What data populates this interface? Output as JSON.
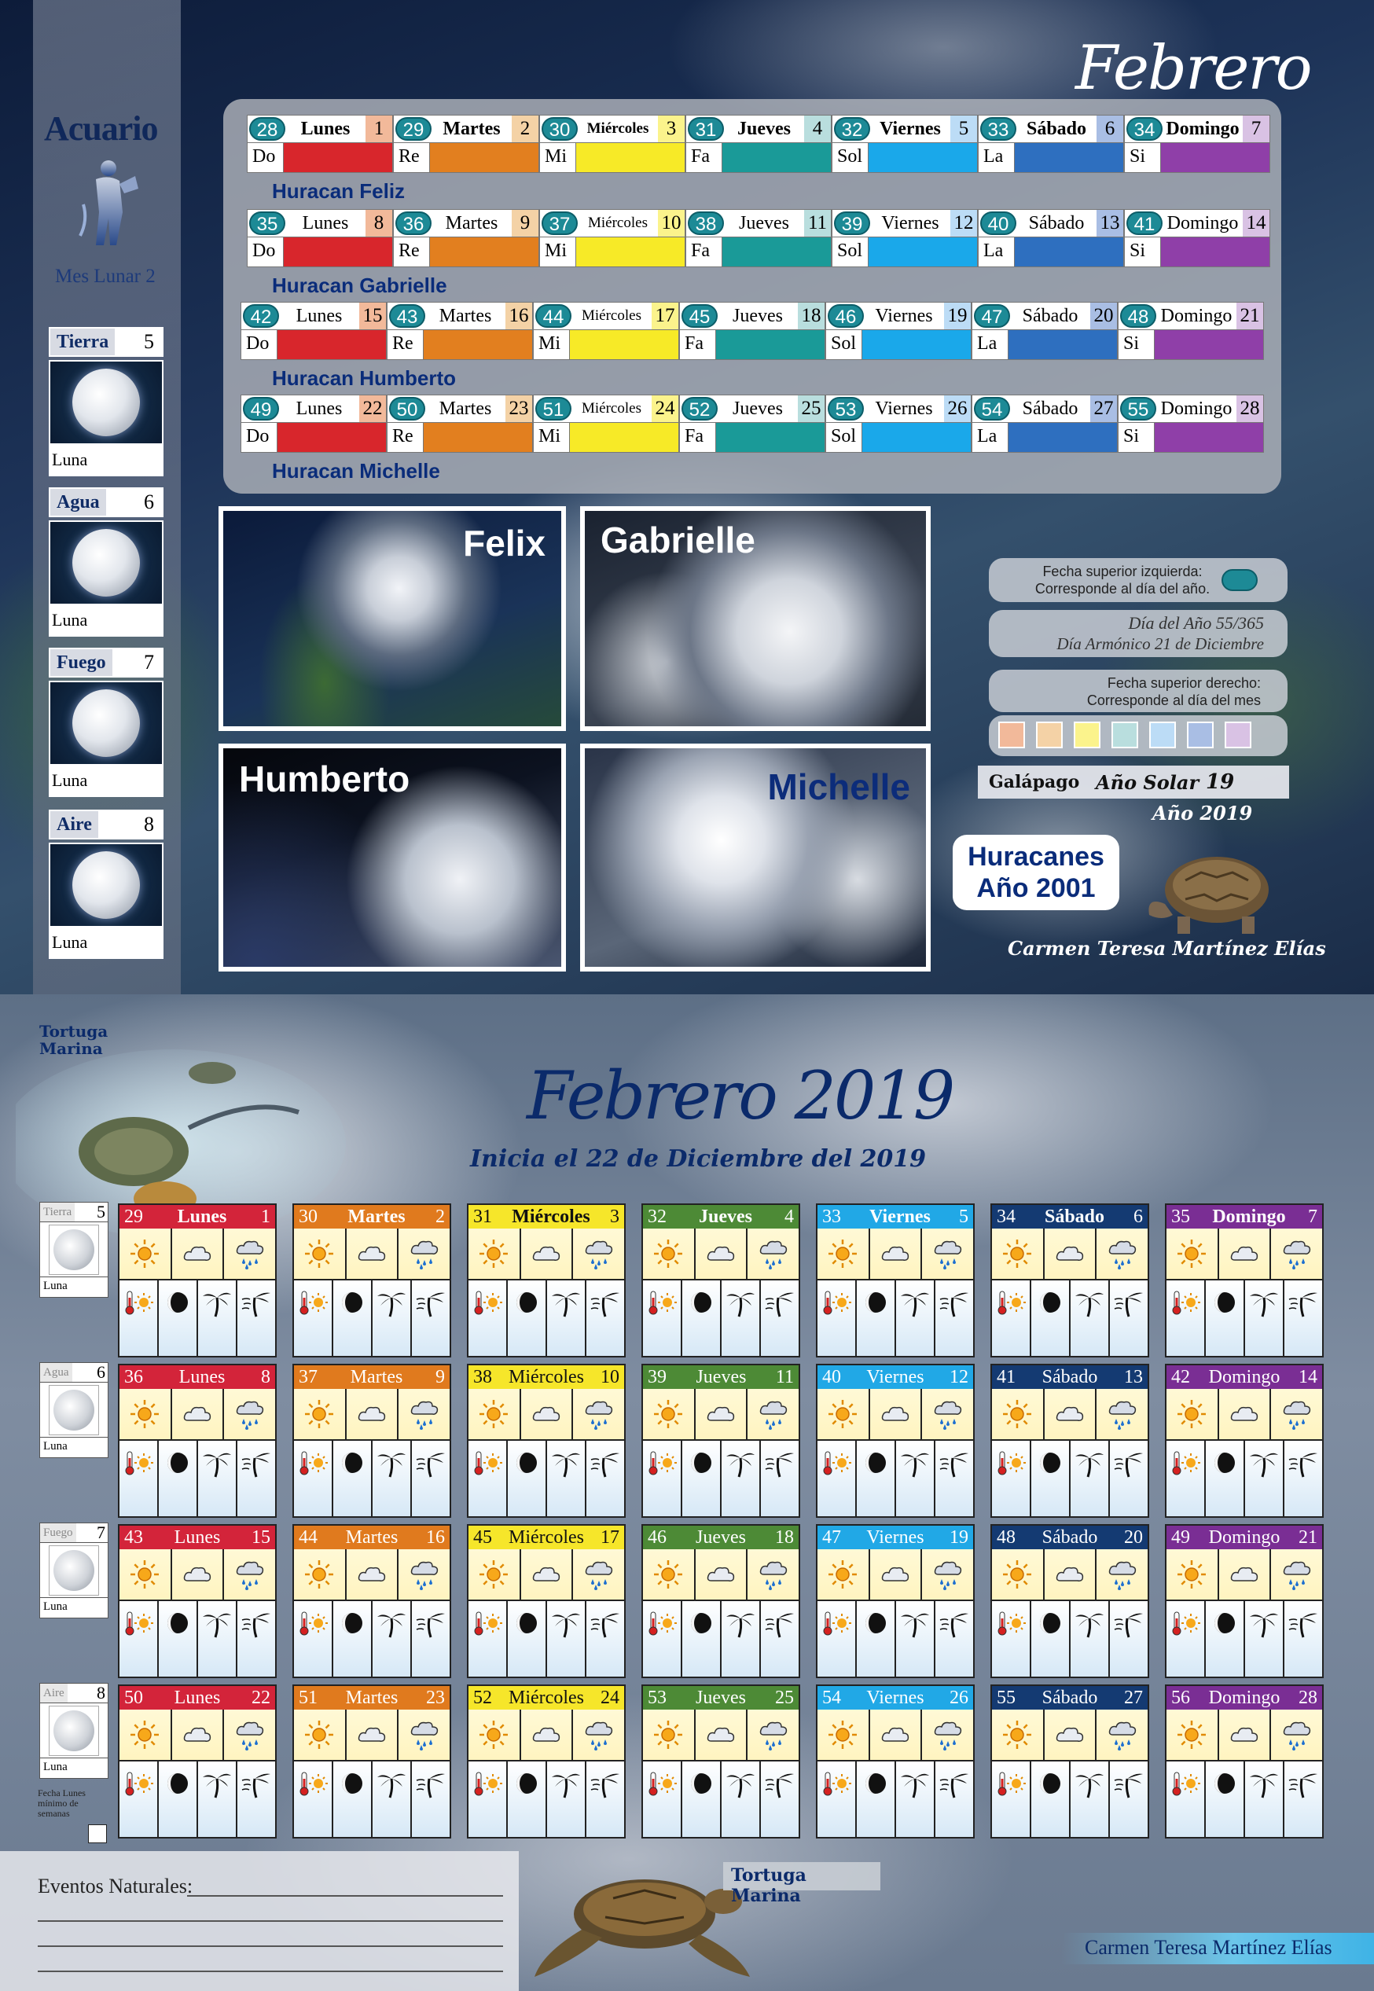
{
  "top": {
    "month_title": "Febrero",
    "sign": {
      "name": "Acuario",
      "lunar": "Mes Lunar 2"
    },
    "elements": [
      {
        "name": "Tierra",
        "num": "5",
        "label": "Luna"
      },
      {
        "name": "Agua",
        "num": "6",
        "label": "Luna"
      },
      {
        "name": "Fuego",
        "num": "7",
        "label": "Luna"
      },
      {
        "name": "Aire",
        "num": "8",
        "label": "Luna"
      }
    ],
    "notes": [
      "Do",
      "Re",
      "Mi",
      "Fa",
      "Sol",
      "La",
      "Si"
    ],
    "note_colors": [
      "#d8262c",
      "#e27f1f",
      "#f7ea27",
      "#1a9a98",
      "#1aa8ea",
      "#2e6fbf",
      "#8f3fa8"
    ],
    "weeks": [
      {
        "hurricane": "Huracan Feliz",
        "days": [
          {
            "doy": "28",
            "name": "Lunes",
            "num": "1"
          },
          {
            "doy": "29",
            "name": "Martes",
            "num": "2"
          },
          {
            "doy": "30",
            "name": "Miércoles",
            "num": "3"
          },
          {
            "doy": "31",
            "name": "Jueves",
            "num": "4"
          },
          {
            "doy": "32",
            "name": "Viernes",
            "num": "5"
          },
          {
            "doy": "33",
            "name": "Sábado",
            "num": "6"
          },
          {
            "doy": "34",
            "name": "Domingo",
            "num": "7"
          }
        ]
      },
      {
        "hurricane": "Huracan Gabrielle",
        "days": [
          {
            "doy": "35",
            "name": "Lunes",
            "num": "8"
          },
          {
            "doy": "36",
            "name": "Martes",
            "num": "9"
          },
          {
            "doy": "37",
            "name": "Miércoles",
            "num": "10"
          },
          {
            "doy": "38",
            "name": "Jueves",
            "num": "11"
          },
          {
            "doy": "39",
            "name": "Viernes",
            "num": "12"
          },
          {
            "doy": "40",
            "name": "Sábado",
            "num": "13"
          },
          {
            "doy": "41",
            "name": "Domingo",
            "num": "14"
          }
        ]
      },
      {
        "hurricane": "Huracan Humberto",
        "days": [
          {
            "doy": "42",
            "name": "Lunes",
            "num": "15"
          },
          {
            "doy": "43",
            "name": "Martes",
            "num": "16"
          },
          {
            "doy": "44",
            "name": "Miércoles",
            "num": "17"
          },
          {
            "doy": "45",
            "name": "Jueves",
            "num": "18"
          },
          {
            "doy": "46",
            "name": "Viernes",
            "num": "19"
          },
          {
            "doy": "47",
            "name": "Sábado",
            "num": "20"
          },
          {
            "doy": "48",
            "name": "Domingo",
            "num": "21"
          }
        ]
      },
      {
        "hurricane": "Huracan Michelle",
        "days": [
          {
            "doy": "49",
            "name": "Lunes",
            "num": "22"
          },
          {
            "doy": "50",
            "name": "Martes",
            "num": "23"
          },
          {
            "doy": "51",
            "name": "Miércoles",
            "num": "24"
          },
          {
            "doy": "52",
            "name": "Jueves",
            "num": "25"
          },
          {
            "doy": "53",
            "name": "Viernes",
            "num": "26"
          },
          {
            "doy": "54",
            "name": "Sábado",
            "num": "27"
          },
          {
            "doy": "55",
            "name": "Domingo",
            "num": "28"
          }
        ]
      }
    ],
    "photos": [
      "Felix",
      "Gabrielle",
      "Humberto",
      "Michelle"
    ],
    "legend": {
      "superior_izq_1": "Fecha superior izquierda:",
      "superior_izq_2": "Corresponde al día del año.",
      "dia_anio": "Día del Año 55/365",
      "dia_armonico": "Día Armónico 21 de Diciembre",
      "superior_der_1": "Fecha superior derecho:",
      "superior_der_2": "Corresponde al día del mes",
      "swatches": [
        "#f2b99a",
        "#f4d2a6",
        "#fbf38c",
        "#b9dede",
        "#bcdcf6",
        "#a9bee4",
        "#d9c2e4"
      ]
    },
    "galapago": "Galápago",
    "anio_solar_label": "Año Solar",
    "anio_solar_num": "19",
    "anio_label": "Año 2019",
    "huracanes_1": "Huracanes",
    "huracanes_2": "Año 2001",
    "author": "Carmen Teresa Martínez Elías"
  },
  "bottom": {
    "title": "Febrero 2019",
    "subtitle": "Inicia el 22 de Diciembre del 2019",
    "tortuga_label_1": "Tortuga",
    "tortuga_label_2": "Marina",
    "elements": [
      {
        "name": "Tierra",
        "num": "5",
        "label": "Luna"
      },
      {
        "name": "Agua",
        "num": "6",
        "label": "Luna"
      },
      {
        "name": "Fuego",
        "num": "7",
        "label": "Luna"
      },
      {
        "name": "Aire",
        "num": "8",
        "label": "Luna"
      }
    ],
    "header_colors": [
      "#d3243a",
      "#e07a1e",
      "#f6e62a",
      "#4d8a36",
      "#21a8e6",
      "#143a72",
      "#7a2e94"
    ],
    "weeks": [
      [
        {
          "doy": "29",
          "name": "Lunes",
          "num": "1"
        },
        {
          "doy": "30",
          "name": "Martes",
          "num": "2"
        },
        {
          "doy": "31",
          "name": "Miércoles",
          "num": "3"
        },
        {
          "doy": "32",
          "name": "Jueves",
          "num": "4"
        },
        {
          "doy": "33",
          "name": "Viernes",
          "num": "5"
        },
        {
          "doy": "34",
          "name": "Sábado",
          "num": "6"
        },
        {
          "doy": "35",
          "name": "Domingo",
          "num": "7"
        }
      ],
      [
        {
          "doy": "36",
          "name": "Lunes",
          "num": "8"
        },
        {
          "doy": "37",
          "name": "Martes",
          "num": "9"
        },
        {
          "doy": "38",
          "name": "Miércoles",
          "num": "10"
        },
        {
          "doy": "39",
          "name": "Jueves",
          "num": "11"
        },
        {
          "doy": "40",
          "name": "Viernes",
          "num": "12"
        },
        {
          "doy": "41",
          "name": "Sábado",
          "num": "13"
        },
        {
          "doy": "42",
          "name": "Domingo",
          "num": "14"
        }
      ],
      [
        {
          "doy": "43",
          "name": "Lunes",
          "num": "15"
        },
        {
          "doy": "44",
          "name": "Martes",
          "num": "16"
        },
        {
          "doy": "45",
          "name": "Miércoles",
          "num": "17"
        },
        {
          "doy": "46",
          "name": "Jueves",
          "num": "18"
        },
        {
          "doy": "47",
          "name": "Viernes",
          "num": "19"
        },
        {
          "doy": "48",
          "name": "Sábado",
          "num": "20"
        },
        {
          "doy": "49",
          "name": "Domingo",
          "num": "21"
        }
      ],
      [
        {
          "doy": "50",
          "name": "Lunes",
          "num": "22"
        },
        {
          "doy": "51",
          "name": "Martes",
          "num": "23"
        },
        {
          "doy": "52",
          "name": "Miércoles",
          "num": "24"
        },
        {
          "doy": "53",
          "name": "Jueves",
          "num": "25"
        },
        {
          "doy": "54",
          "name": "Viernes",
          "num": "26"
        },
        {
          "doy": "55",
          "name": "Sábado",
          "num": "27"
        },
        {
          "doy": "56",
          "name": "Domingo",
          "num": "28"
        }
      ]
    ],
    "icons_row1": [
      "sun-icon",
      "cloud-icon",
      "rain-cloud-icon"
    ],
    "icons_row2": [
      "thermometer-sun-icon",
      "moon-phase-icon",
      "palm-tree-icon",
      "wind-palm-icon"
    ],
    "fecha_note": "Fecha Lunes mínimo de semanas",
    "eventos_label": "Eventos Naturales:",
    "tortuga_marina": "Tortuga Marina",
    "author": "Carmen Teresa Martínez Elías"
  }
}
